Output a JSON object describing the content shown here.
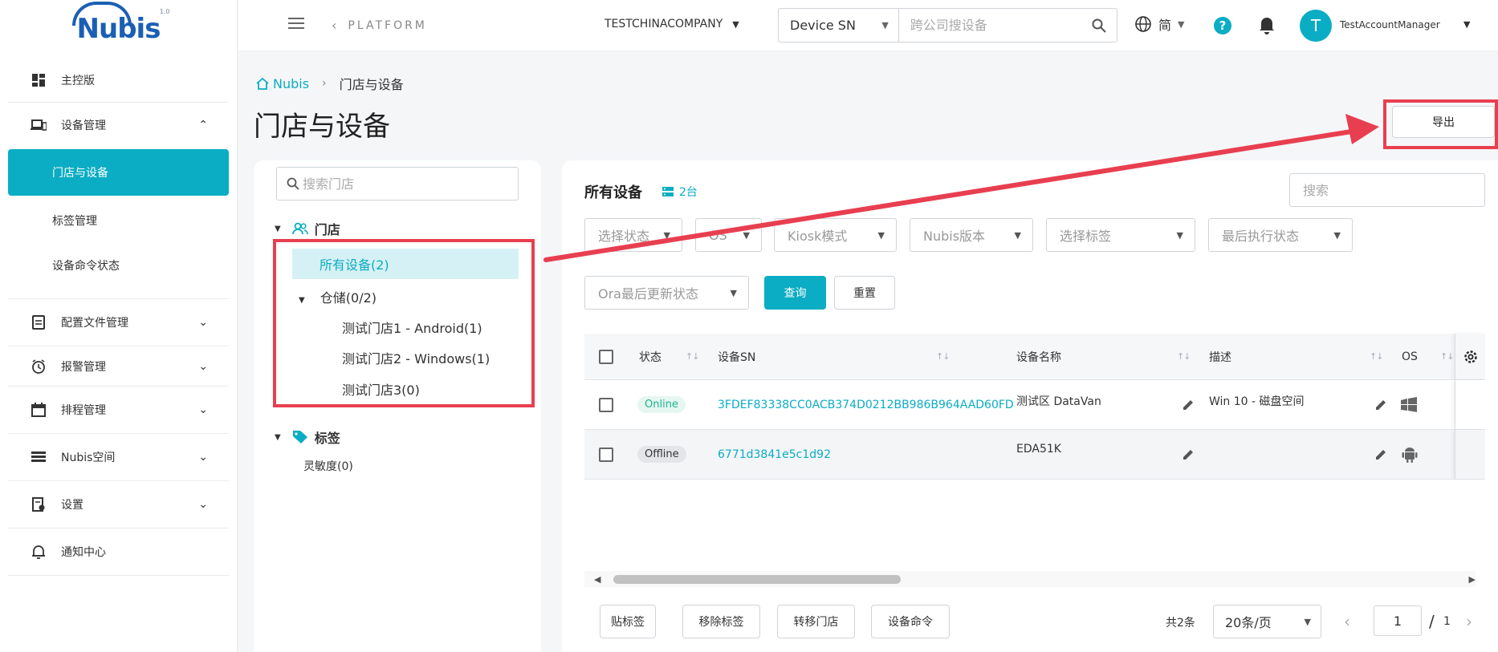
{
  "logo": {
    "text": "Nubis",
    "version": "1.0"
  },
  "sidebar": {
    "items": [
      {
        "label": "主控版",
        "icon": "dashboard-icon"
      },
      {
        "label": "设备管理",
        "icon": "devices-icon",
        "expanded": true,
        "children": [
          {
            "label": "门店与设备",
            "active": true
          },
          {
            "label": "标签管理"
          },
          {
            "label": "设备命令状态"
          }
        ]
      },
      {
        "label": "配置文件管理",
        "icon": "config-file-icon"
      },
      {
        "label": "报警管理",
        "icon": "alarm-icon"
      },
      {
        "label": "排程管理",
        "icon": "calendar-icon"
      },
      {
        "label": "Nubis空间",
        "icon": "storage-icon"
      },
      {
        "label": "设置",
        "icon": "settings-doc-icon"
      },
      {
        "label": "通知中心",
        "icon": "notification-icon"
      }
    ]
  },
  "topbar": {
    "platform": "PLATFORM",
    "company": "TESTCHINACOMPANY",
    "search_type": "Device SN",
    "search_placeholder": "跨公司搜设备",
    "language": "简",
    "help": "?",
    "avatar_letter": "T",
    "user": "TestAccountManager"
  },
  "breadcrumb": {
    "home": "Nubis",
    "current": "门店与设备"
  },
  "page_title": "门店与设备",
  "export_label": "导出",
  "left_panel": {
    "search_placeholder": "搜索门店",
    "stores_header": "门店",
    "all_devices": "所有设备(2)",
    "group": "仓储(0/2)",
    "stores": [
      "测试门店1 - Android(1)",
      "测试门店2 - Windows(1)",
      "测试门店3(0)"
    ],
    "tags_header": "标签",
    "tags": [
      "灵敏度(0)"
    ]
  },
  "right_panel": {
    "title": "所有设备",
    "count": "2台",
    "search_placeholder": "搜索",
    "filters": [
      "选择状态",
      "OS",
      "Kiosk模式",
      "Nubis版本",
      "选择标签",
      "最后执行状态",
      "Ora最后更新状态"
    ],
    "query_label": "查询",
    "reset_label": "重置",
    "columns": [
      "状态",
      "设备SN",
      "设备名称",
      "描述",
      "OS"
    ],
    "rows": [
      {
        "status": "Online",
        "sn": "3FDEF83338CC0ACB374D0212BB986B964AAD60FD",
        "name": "测试区 DataVan",
        "desc": "Win 10 - 磁盘空间",
        "os": "windows-icon"
      },
      {
        "status": "Offline",
        "sn": "6771d3841e5c1d92",
        "name": "EDA51K",
        "desc": "",
        "os": "android-icon"
      }
    ],
    "bottom_buttons": [
      "贴标签",
      "移除标签",
      "转移门店",
      "设备命令"
    ],
    "total": "共2条",
    "page_size": "20条/页",
    "page": "1",
    "page_sep": "/",
    "page_total": "1"
  },
  "colors": {
    "accent": "#0aadc3",
    "annotation": "#e83f50",
    "online": "#1bb48a"
  }
}
